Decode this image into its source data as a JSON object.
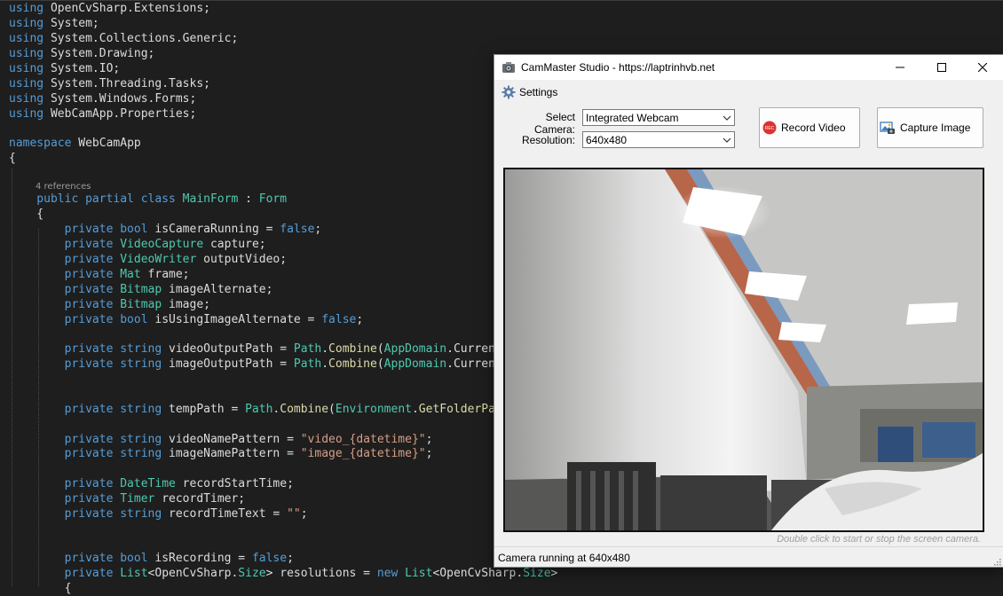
{
  "editor": {
    "lines": [
      [
        {
          "t": "using ",
          "c": "kw"
        },
        {
          "t": "OpenCvSharp.Extensions;",
          "c": "plain"
        }
      ],
      [
        {
          "t": "using ",
          "c": "kw"
        },
        {
          "t": "System;",
          "c": "plain"
        }
      ],
      [
        {
          "t": "using ",
          "c": "kw"
        },
        {
          "t": "System.Collections.Generic;",
          "c": "plain"
        }
      ],
      [
        {
          "t": "using ",
          "c": "kw"
        },
        {
          "t": "System.Drawing;",
          "c": "plain"
        }
      ],
      [
        {
          "t": "using ",
          "c": "kw"
        },
        {
          "t": "System.IO;",
          "c": "plain"
        }
      ],
      [
        {
          "t": "using ",
          "c": "kw"
        },
        {
          "t": "System.Threading.Tasks;",
          "c": "plain"
        }
      ],
      [
        {
          "t": "using ",
          "c": "kw"
        },
        {
          "t": "System.Windows.Forms;",
          "c": "plain"
        }
      ],
      [
        {
          "t": "using ",
          "c": "kw"
        },
        {
          "t": "WebCamApp.Properties;",
          "c": "plain"
        }
      ],
      [],
      [
        {
          "t": "namespace ",
          "c": "kw"
        },
        {
          "t": "WebCamApp",
          "c": "plain"
        }
      ],
      [
        {
          "t": "{",
          "c": "plain"
        }
      ],
      [],
      [
        {
          "t": "    public partial class ",
          "c": "kw"
        },
        {
          "t": "MainForm",
          "c": "ty"
        },
        {
          "t": " : ",
          "c": "plain"
        },
        {
          "t": "Form",
          "c": "ty"
        }
      ],
      [
        {
          "t": "    {",
          "c": "plain"
        }
      ],
      [
        {
          "t": "        private bool ",
          "c": "kw"
        },
        {
          "t": "isCameraRunning = ",
          "c": "plain"
        },
        {
          "t": "false",
          "c": "kw"
        },
        {
          "t": ";",
          "c": "plain"
        }
      ],
      [
        {
          "t": "        private ",
          "c": "kw"
        },
        {
          "t": "VideoCapture",
          "c": "ty"
        },
        {
          "t": " capture;",
          "c": "plain"
        }
      ],
      [
        {
          "t": "        private ",
          "c": "kw"
        },
        {
          "t": "VideoWriter",
          "c": "ty"
        },
        {
          "t": " outputVideo;",
          "c": "plain"
        }
      ],
      [
        {
          "t": "        private ",
          "c": "kw"
        },
        {
          "t": "Mat",
          "c": "ty"
        },
        {
          "t": " frame;",
          "c": "plain"
        }
      ],
      [
        {
          "t": "        private ",
          "c": "kw"
        },
        {
          "t": "Bitmap",
          "c": "ty"
        },
        {
          "t": " imageAlternate;",
          "c": "plain"
        }
      ],
      [
        {
          "t": "        private ",
          "c": "kw"
        },
        {
          "t": "Bitmap",
          "c": "ty"
        },
        {
          "t": " image;",
          "c": "plain"
        }
      ],
      [
        {
          "t": "        private bool ",
          "c": "kw"
        },
        {
          "t": "isUsingImageAlternate = ",
          "c": "plain"
        },
        {
          "t": "false",
          "c": "kw"
        },
        {
          "t": ";",
          "c": "plain"
        }
      ],
      [],
      [
        {
          "t": "        private string ",
          "c": "kw"
        },
        {
          "t": "videoOutputPath = ",
          "c": "plain"
        },
        {
          "t": "Path",
          "c": "ty"
        },
        {
          "t": ".",
          "c": "plain"
        },
        {
          "t": "Combine",
          "c": "mt"
        },
        {
          "t": "(",
          "c": "plain"
        },
        {
          "t": "AppDomain",
          "c": "ty"
        },
        {
          "t": ".",
          "c": "plain"
        },
        {
          "t": "CurrentDo",
          "c": "plain"
        }
      ],
      [
        {
          "t": "        private string ",
          "c": "kw"
        },
        {
          "t": "imageOutputPath = ",
          "c": "plain"
        },
        {
          "t": "Path",
          "c": "ty"
        },
        {
          "t": ".",
          "c": "plain"
        },
        {
          "t": "Combine",
          "c": "mt"
        },
        {
          "t": "(",
          "c": "plain"
        },
        {
          "t": "AppDomain",
          "c": "ty"
        },
        {
          "t": ".",
          "c": "plain"
        },
        {
          "t": "CurrentDo",
          "c": "plain"
        }
      ],
      [],
      [],
      [
        {
          "t": "        private string ",
          "c": "kw"
        },
        {
          "t": "tempPath = ",
          "c": "plain"
        },
        {
          "t": "Path",
          "c": "ty"
        },
        {
          "t": ".",
          "c": "plain"
        },
        {
          "t": "Combine",
          "c": "mt"
        },
        {
          "t": "(",
          "c": "plain"
        },
        {
          "t": "Environment",
          "c": "ty"
        },
        {
          "t": ".",
          "c": "plain"
        },
        {
          "t": "GetFolderPath",
          "c": "mt"
        },
        {
          "t": "(",
          "c": "plain"
        }
      ],
      [],
      [
        {
          "t": "        private string ",
          "c": "kw"
        },
        {
          "t": "videoNamePattern = ",
          "c": "plain"
        },
        {
          "t": "\"video_{datetime}\"",
          "c": "st"
        },
        {
          "t": ";",
          "c": "plain"
        }
      ],
      [
        {
          "t": "        private string ",
          "c": "kw"
        },
        {
          "t": "imageNamePattern = ",
          "c": "plain"
        },
        {
          "t": "\"image_{datetime}\"",
          "c": "st"
        },
        {
          "t": ";",
          "c": "plain"
        }
      ],
      [],
      [
        {
          "t": "        private ",
          "c": "kw"
        },
        {
          "t": "DateTime",
          "c": "ty"
        },
        {
          "t": " recordStartTime;",
          "c": "plain"
        }
      ],
      [
        {
          "t": "        private ",
          "c": "kw"
        },
        {
          "t": "Timer",
          "c": "ty"
        },
        {
          "t": " recordTimer;",
          "c": "plain"
        }
      ],
      [
        {
          "t": "        private string ",
          "c": "kw"
        },
        {
          "t": "recordTimeText = ",
          "c": "plain"
        },
        {
          "t": "\"\"",
          "c": "st"
        },
        {
          "t": ";",
          "c": "plain"
        }
      ],
      [],
      [],
      [
        {
          "t": "        private bool ",
          "c": "kw"
        },
        {
          "t": "isRecording = ",
          "c": "plain"
        },
        {
          "t": "false",
          "c": "kw"
        },
        {
          "t": ";",
          "c": "plain"
        }
      ],
      [
        {
          "t": "        private ",
          "c": "kw"
        },
        {
          "t": "List",
          "c": "ty"
        },
        {
          "t": "<OpenCvSharp.",
          "c": "plain"
        },
        {
          "t": "Size",
          "c": "ty"
        },
        {
          "t": "> resolutions = ",
          "c": "plain"
        },
        {
          "t": "new ",
          "c": "kw"
        },
        {
          "t": "List",
          "c": "ty"
        },
        {
          "t": "<OpenCvSharp.",
          "c": "plain"
        },
        {
          "t": "Size",
          "c": "ty"
        },
        {
          "t": ">",
          "c": "plain"
        }
      ],
      [
        {
          "t": "        {",
          "c": "plain"
        }
      ]
    ],
    "references_label": "4 references"
  },
  "window": {
    "title": "CamMaster Studio - https://laptrinhvb.net",
    "menu_settings": "Settings",
    "select_camera_label": "Select Camera:",
    "camera_value": "Integrated Webcam",
    "resolution_label": "Resolution:",
    "resolution_value": "640x480",
    "record_button": "Record Video",
    "record_icon_text": "REC",
    "capture_button": "Capture Image",
    "hint": "Double click to start or stop the screen camera.",
    "status": "Camera running at 640x480"
  },
  "colors": {
    "keyword": "#569cd6",
    "type": "#4ec9b0",
    "string": "#d69d85",
    "method": "#dcdcaa",
    "record_red": "#e03131"
  }
}
